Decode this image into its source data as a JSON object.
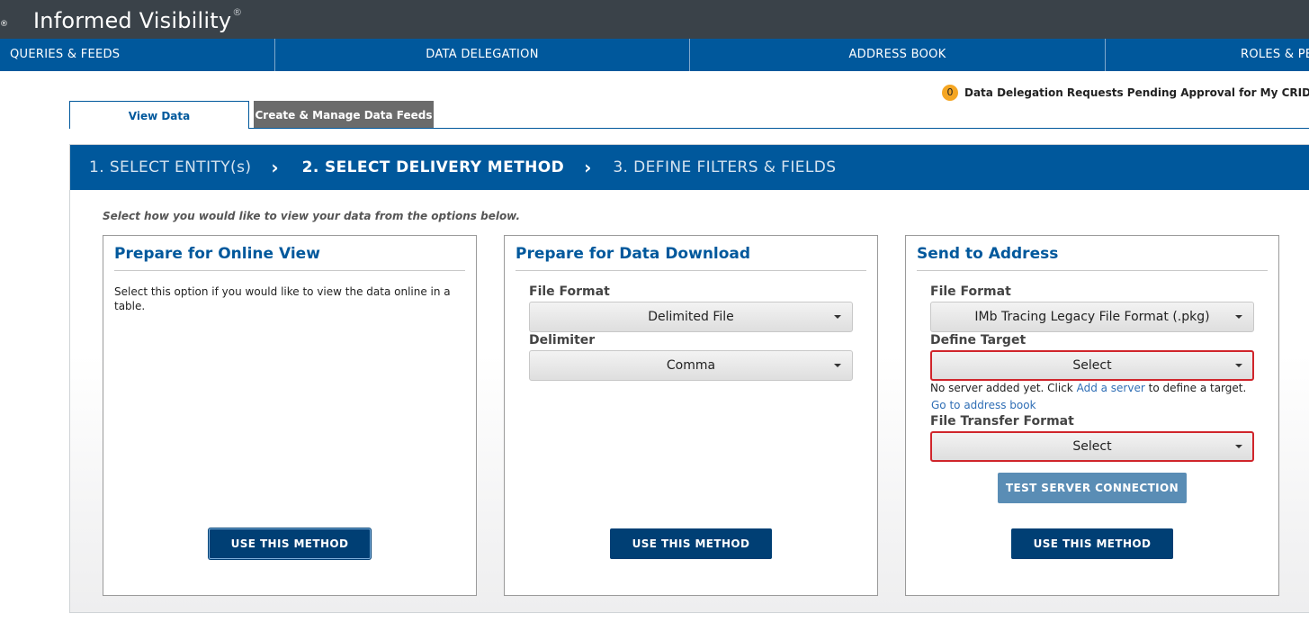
{
  "header": {
    "brand": "Informed Visibility",
    "registered_mark": "®",
    "left_mark": "®"
  },
  "nav": {
    "items": [
      {
        "label": "QUERIES & FEEDS"
      },
      {
        "label": "DATA DELEGATION"
      },
      {
        "label": "ADDRESS BOOK"
      },
      {
        "label": "ROLES & PERMISSIONS"
      }
    ]
  },
  "pending": {
    "count": "0",
    "text": "Data Delegation Requests Pending Approval for My CRID"
  },
  "tabs": {
    "view_data": "View Data",
    "create_manage": "Create & Manage Data Feeds"
  },
  "steps": [
    {
      "label": "1. SELECT ENTITY(s)"
    },
    {
      "label": "2. SELECT DELIVERY METHOD"
    },
    {
      "label": "3. DEFINE FILTERS & FIELDS"
    }
  ],
  "instructions": "Select how you would like to view your data from the options below.",
  "cards": {
    "online": {
      "title": "Prepare for Online View",
      "description": "Select this option if you would like to view the data online in a table.",
      "button": "USE THIS METHOD"
    },
    "download": {
      "title": "Prepare for Data Download",
      "file_format_label": "File Format",
      "file_format_value": "Delimited File",
      "delimiter_label": "Delimiter",
      "delimiter_value": "Comma",
      "button": "USE THIS METHOD"
    },
    "address": {
      "title": "Send to Address",
      "file_format_label": "File Format",
      "file_format_value": "IMb Tracing Legacy File Format (.pkg)",
      "define_target_label": "Define Target",
      "define_target_value": "Select",
      "help_prefix": "No server added yet. Click",
      "help_link": "Add a server",
      "help_suffix": "to define a target.",
      "address_book_link": "Go to address book",
      "transfer_format_label": "File Transfer Format",
      "transfer_format_value": "Select",
      "test_button": "TEST SERVER CONNECTION",
      "button": "USE THIS METHOD"
    }
  },
  "colors": {
    "brand_blue": "#00589c",
    "header_dark": "#3a4249",
    "button_navy": "#003f74",
    "error_red": "#d0252b",
    "badge_orange": "#f5a623"
  }
}
